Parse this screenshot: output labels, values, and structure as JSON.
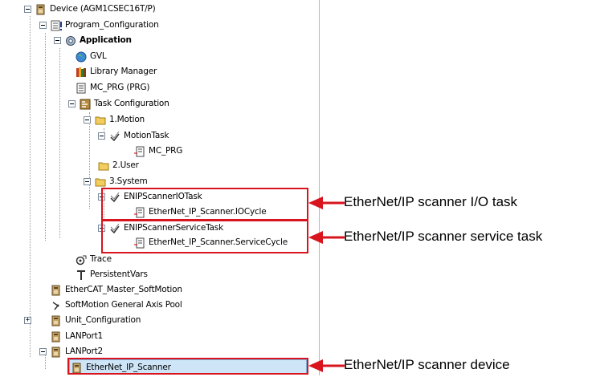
{
  "tree": {
    "device": "Device (AGM1CSEC16T/P)",
    "program_configuration": "Program_Configuration",
    "application": "Application",
    "gvl": "GVL",
    "library_manager": "Library Manager",
    "mc_prg": "MC_PRG (PRG)",
    "task_configuration": "Task Configuration",
    "motion_folder": "1.Motion",
    "motion_task": "MotionTask",
    "motion_task_call": "MC_PRG",
    "user_folder": "2.User",
    "system_folder": "3.System",
    "enip_io_task": "ENIPScannerIOTask",
    "enip_io_call": "EtherNet_IP_Scanner.IOCycle",
    "enip_service_task": "ENIPScannerServiceTask",
    "enip_service_call": "EtherNet_IP_Scanner.ServiceCycle",
    "trace": "Trace",
    "persistent_vars": "PersistentVars",
    "ethercat_master": "EtherCAT_Master_SoftMotion",
    "axis_pool": "SoftMotion General Axis Pool",
    "unit_configuration": "Unit_Configuration",
    "lanport1": "LANPort1",
    "lanport2": "LANPort2",
    "enip_scanner": "EtherNet_IP_Scanner"
  },
  "annotations": {
    "io_task": "EtherNet/IP scanner I/O task",
    "service_task": "EtherNet/IP scanner service task",
    "device": "EtherNet/IP scanner device"
  },
  "colors": {
    "highlight_red": "#d8141e",
    "selection_fill": "#cde5f7"
  }
}
